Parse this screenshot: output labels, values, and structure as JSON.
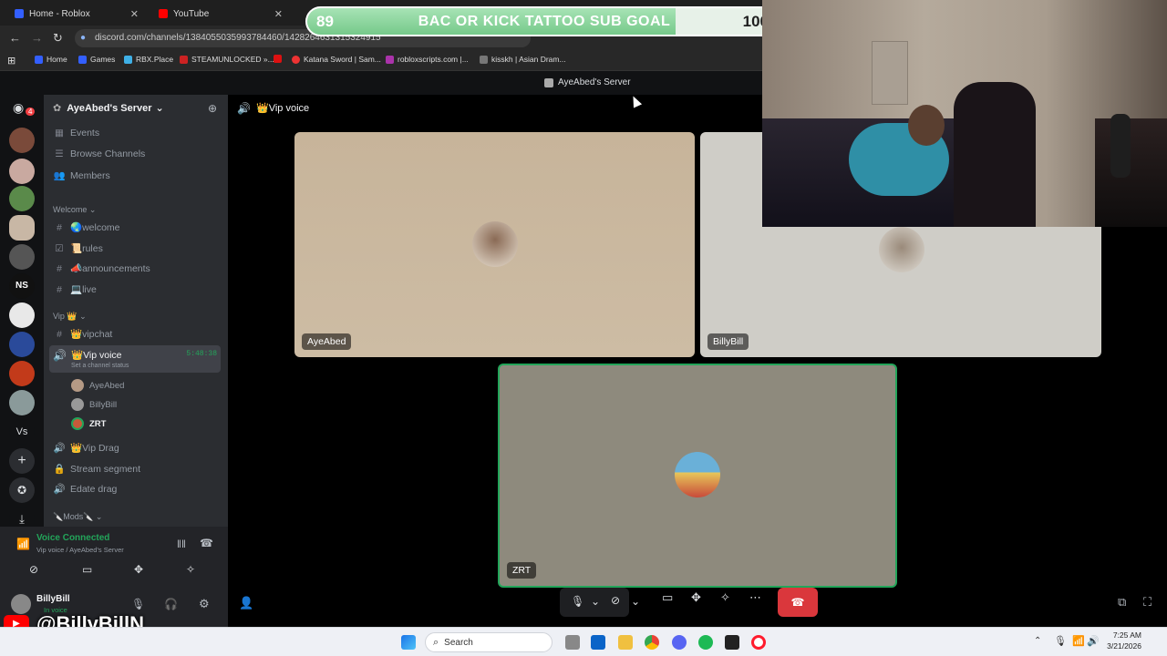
{
  "browser": {
    "tabs": [
      {
        "label": "Home - Roblox"
      },
      {
        "label": "YouTube"
      }
    ],
    "url": "discord.com/channels/1384055035993784460/1428264631315324915",
    "bookmarks": [
      "Home",
      "Games",
      "RBX.Place",
      "STEAMUNLOCKED »...",
      "Katana Sword | Sam...",
      "robloxscripts.com |...",
      "kisskh | Asian Dram..."
    ]
  },
  "stream_goal": {
    "current": "89",
    "label": "BAC OR KICK TATTOO SUB GOAL",
    "target": "100",
    "progress": 0.89
  },
  "discord": {
    "window_title": "AyeAbed's Server",
    "badge_count": "4",
    "server_list": [
      "NS",
      "Vs"
    ],
    "server": {
      "name": "AyeAbed's Server",
      "top_items": [
        "Events",
        "Browse Channels",
        "Members"
      ],
      "categories": [
        {
          "name": "Welcome",
          "channels": [
            "🌏welcome",
            "📜rules",
            "📣announcements",
            "💻live"
          ]
        },
        {
          "name": "Vip 👑",
          "channels": [
            "👑vipchat"
          ]
        }
      ],
      "active_channel": {
        "name": "👑Vip voice",
        "timer": "5:48:38",
        "status": "Set a channel status"
      },
      "voice_members": [
        "AyeAbed",
        "BillyBill",
        "ZRT"
      ],
      "more_channels": [
        "👑Vip Drag",
        "Stream segment",
        "Edate drag"
      ],
      "mods_category": "🔪Mods🔪"
    },
    "voice": {
      "status": "Voice Connected",
      "location": "Vip voice / AyeAbed's Server"
    },
    "user": {
      "name": "BillyBill",
      "status": "In voice"
    },
    "stage": {
      "channel_title": "👑Vip voice",
      "tiles": [
        {
          "name": "AyeAbed",
          "bg": "#c9b79d"
        },
        {
          "name": "BillyBill",
          "bg": "#cfcdc7"
        },
        {
          "name": "ZRT",
          "bg": "#8e8a7d"
        }
      ]
    }
  },
  "overlay_handle": "@BillyBillN",
  "taskbar": {
    "search_placeholder": "Search",
    "time": "7:25 AM",
    "date": "3/21/2026"
  }
}
